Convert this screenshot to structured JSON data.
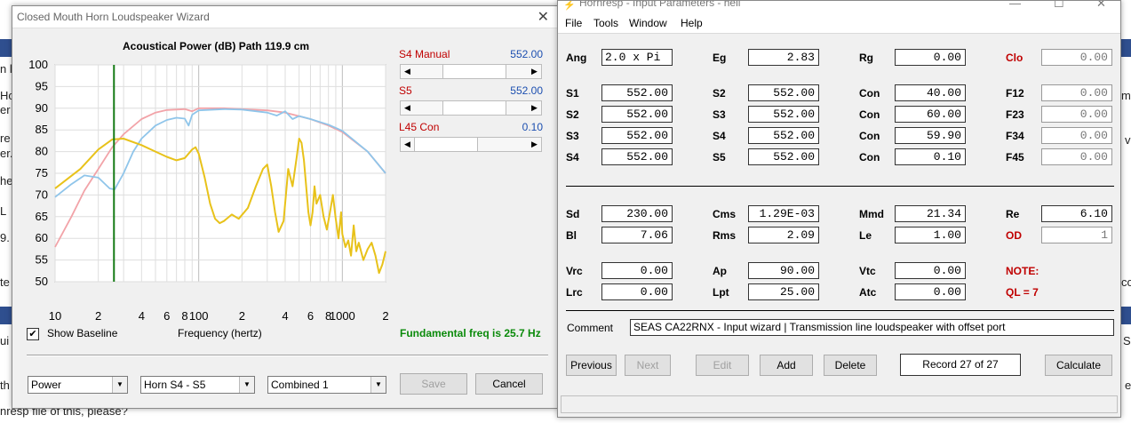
{
  "background": {
    "fragments": [
      "n l",
      "Ho",
      "er",
      "re",
      "er.",
      "he",
      "L",
      "9.",
      "te",
      "ui",
      "th",
      "nresp file of this, please?",
      "m",
      "v",
      "co",
      "S",
      "e"
    ]
  },
  "wizard": {
    "title": "Closed Mouth Horn Loudspeaker Wizard",
    "close_glyph": "✕",
    "graph_title": "Acoustical Power (dB)   Path 119.9 cm",
    "y_ticks": [
      "100",
      "95",
      "90",
      "85",
      "80",
      "75",
      "70",
      "65",
      "60",
      "55",
      "50"
    ],
    "x_ticks": [
      "10",
      "2",
      "4",
      "6",
      "8",
      "100",
      "2",
      "4",
      "6",
      "8",
      "1000",
      "2"
    ],
    "x_axis_label": "Frequency (hertz)",
    "show_baseline": {
      "label": "Show Baseline",
      "checked": true,
      "check_glyph": "✔"
    },
    "fundamental": "Fundamental freq is 25.7 Hz",
    "sliders": [
      {
        "label": "S4  Manual",
        "value": "552.00",
        "position": 0.55
      },
      {
        "label": "S5",
        "value": "552.00",
        "position": 0.55
      },
      {
        "label": "L45  Con",
        "value": "0.10",
        "position": 0.0
      }
    ],
    "combos": [
      "Power",
      "Horn S4 - S5",
      "Combined 1"
    ],
    "buttons": {
      "save": "Save",
      "cancel": "Cancel"
    },
    "colors": {
      "pink": "#f2a3a8",
      "blue": "#8fc5ea",
      "yellow": "#e8c21a",
      "marker": "#157a15"
    }
  },
  "chart_data": {
    "type": "line",
    "xscale": "log",
    "xlim": [
      10,
      2000
    ],
    "ylim": [
      50,
      100
    ],
    "xlabel": "Frequency (hertz)",
    "title": "Acoustical Power (dB)   Path 119.9 cm",
    "marker_freq": 25.7,
    "series": [
      {
        "color": "#f2a3a8",
        "points": [
          [
            10,
            58
          ],
          [
            13,
            65
          ],
          [
            16,
            71
          ],
          [
            20,
            76
          ],
          [
            25,
            81
          ],
          [
            30,
            84
          ],
          [
            40,
            87.5
          ],
          [
            50,
            89
          ],
          [
            60,
            89.6
          ],
          [
            80,
            89.8
          ],
          [
            90,
            89.3
          ],
          [
            100,
            90
          ],
          [
            150,
            90
          ],
          [
            200,
            89.8
          ],
          [
            300,
            89.5
          ],
          [
            400,
            89
          ],
          [
            600,
            87.5
          ],
          [
            800,
            86
          ],
          [
            1000,
            84.5
          ],
          [
            1500,
            80
          ],
          [
            2000,
            75
          ]
        ]
      },
      {
        "color": "#8fc5ea",
        "points": [
          [
            10,
            69.5
          ],
          [
            13,
            72.5
          ],
          [
            16,
            74.5
          ],
          [
            20,
            74
          ],
          [
            24,
            71.5
          ],
          [
            26,
            71.3
          ],
          [
            30,
            75
          ],
          [
            35,
            80
          ],
          [
            40,
            83
          ],
          [
            50,
            86
          ],
          [
            60,
            87.3
          ],
          [
            70,
            87.8
          ],
          [
            80,
            87.6
          ],
          [
            85,
            86
          ],
          [
            90,
            88.5
          ],
          [
            100,
            89.5
          ],
          [
            150,
            89.8
          ],
          [
            200,
            89.7
          ],
          [
            300,
            89
          ],
          [
            350,
            88.3
          ],
          [
            400,
            89.3
          ],
          [
            450,
            87.5
          ],
          [
            500,
            88.2
          ],
          [
            600,
            87.5
          ],
          [
            800,
            86.2
          ],
          [
            1000,
            84.8
          ],
          [
            1500,
            80
          ],
          [
            2000,
            75
          ]
        ]
      },
      {
        "color": "#e8c21a",
        "points": [
          [
            10,
            71.5
          ],
          [
            15,
            76
          ],
          [
            20,
            80.5
          ],
          [
            25,
            82.8
          ],
          [
            30,
            83
          ],
          [
            40,
            81.5
          ],
          [
            50,
            80
          ],
          [
            60,
            78.8
          ],
          [
            70,
            78
          ],
          [
            80,
            78.5
          ],
          [
            90,
            80.5
          ],
          [
            95,
            81
          ],
          [
            100,
            79.5
          ],
          [
            110,
            74
          ],
          [
            120,
            68
          ],
          [
            130,
            64.5
          ],
          [
            140,
            63.5
          ],
          [
            150,
            64
          ],
          [
            170,
            65.5
          ],
          [
            190,
            64.5
          ],
          [
            220,
            67
          ],
          [
            250,
            72
          ],
          [
            280,
            76
          ],
          [
            300,
            77
          ],
          [
            320,
            72
          ],
          [
            340,
            66
          ],
          [
            360,
            61.5
          ],
          [
            390,
            64
          ],
          [
            420,
            76
          ],
          [
            450,
            72
          ],
          [
            480,
            78.5
          ],
          [
            500,
            83
          ],
          [
            520,
            82
          ],
          [
            540,
            78
          ],
          [
            560,
            72
          ],
          [
            580,
            66
          ],
          [
            600,
            63
          ],
          [
            620,
            66
          ],
          [
            640,
            72
          ],
          [
            660,
            68
          ],
          [
            700,
            70
          ],
          [
            740,
            65
          ],
          [
            780,
            62
          ],
          [
            820,
            66
          ],
          [
            860,
            70
          ],
          [
            900,
            64.5
          ],
          [
            940,
            60
          ],
          [
            980,
            66
          ],
          [
            1000,
            61
          ],
          [
            1050,
            58
          ],
          [
            1100,
            59.5
          ],
          [
            1150,
            56
          ],
          [
            1200,
            63
          ],
          [
            1250,
            57
          ],
          [
            1300,
            59
          ],
          [
            1400,
            55
          ],
          [
            1500,
            57.5
          ],
          [
            1600,
            59
          ],
          [
            1700,
            56
          ],
          [
            1800,
            52
          ],
          [
            1900,
            54
          ],
          [
            2000,
            57
          ]
        ]
      }
    ]
  },
  "hornresp": {
    "title": "Hornresp - Input Parameters - hell",
    "title_icon": "⚡",
    "controls": [
      "—",
      "☐",
      "✕"
    ],
    "menu": [
      "File",
      "Tools",
      "Window",
      "Help"
    ],
    "rows": [
      [
        {
          "l": "Ang",
          "v": "2.0 x Pi",
          "left": true
        },
        {
          "l": "Eg",
          "v": "2.83"
        },
        {
          "l": "Rg",
          "v": "0.00"
        },
        {
          "l": "Clo",
          "v": "0.00",
          "red": true,
          "gray": true
        }
      ],
      [
        {
          "l": "S1",
          "v": "552.00"
        },
        {
          "l": "S2",
          "v": "552.00"
        },
        {
          "l": "Con",
          "v": "40.00"
        },
        {
          "l": "F12",
          "v": "0.00",
          "gray": true
        }
      ],
      [
        {
          "l": "S2",
          "v": "552.00"
        },
        {
          "l": "S3",
          "v": "552.00"
        },
        {
          "l": "Con",
          "v": "60.00"
        },
        {
          "l": "F23",
          "v": "0.00",
          "gray": true
        }
      ],
      [
        {
          "l": "S3",
          "v": "552.00"
        },
        {
          "l": "S4",
          "v": "552.00"
        },
        {
          "l": "Con",
          "v": "59.90"
        },
        {
          "l": "F34",
          "v": "0.00",
          "gray": true
        }
      ],
      [
        {
          "l": "S4",
          "v": "552.00"
        },
        {
          "l": "S5",
          "v": "552.00"
        },
        {
          "l": "Con",
          "v": "0.10"
        },
        {
          "l": "F45",
          "v": "0.00",
          "gray": true
        }
      ],
      [
        {
          "l": "Sd",
          "v": "230.00"
        },
        {
          "l": "Cms",
          "v": "1.29E-03"
        },
        {
          "l": "Mmd",
          "v": "21.34"
        },
        {
          "l": "Re",
          "v": "6.10"
        }
      ],
      [
        {
          "l": "Bl",
          "v": "7.06"
        },
        {
          "l": "Rms",
          "v": "2.09"
        },
        {
          "l": "Le",
          "v": "1.00"
        },
        {
          "l": "OD",
          "v": "1",
          "red": true,
          "gray": true
        }
      ],
      [
        {
          "l": "Vrc",
          "v": "0.00"
        },
        {
          "l": "Ap",
          "v": "90.00"
        },
        {
          "l": "Vtc",
          "v": "0.00"
        },
        {
          "l": "NOTE:",
          "red": true
        }
      ],
      [
        {
          "l": "Lrc",
          "v": "0.00"
        },
        {
          "l": "Lpt",
          "v": "25.00"
        },
        {
          "l": "Atc",
          "v": "0.00"
        },
        {
          "l": "QL = 7",
          "red": true
        }
      ]
    ],
    "comment_label": "Comment",
    "comment": "SEAS CA22RNX - Input wizard | Transmission line loudspeaker with offset port",
    "buttons": [
      {
        "label": "Previous",
        "disabled": false
      },
      {
        "label": "Next",
        "disabled": true
      },
      {
        "label": "Edit",
        "disabled": true
      },
      {
        "label": "Add",
        "disabled": false
      },
      {
        "label": "Delete",
        "disabled": false
      },
      {
        "label": "Calculate",
        "disabled": false
      }
    ],
    "record": "Record 27 of 27"
  }
}
